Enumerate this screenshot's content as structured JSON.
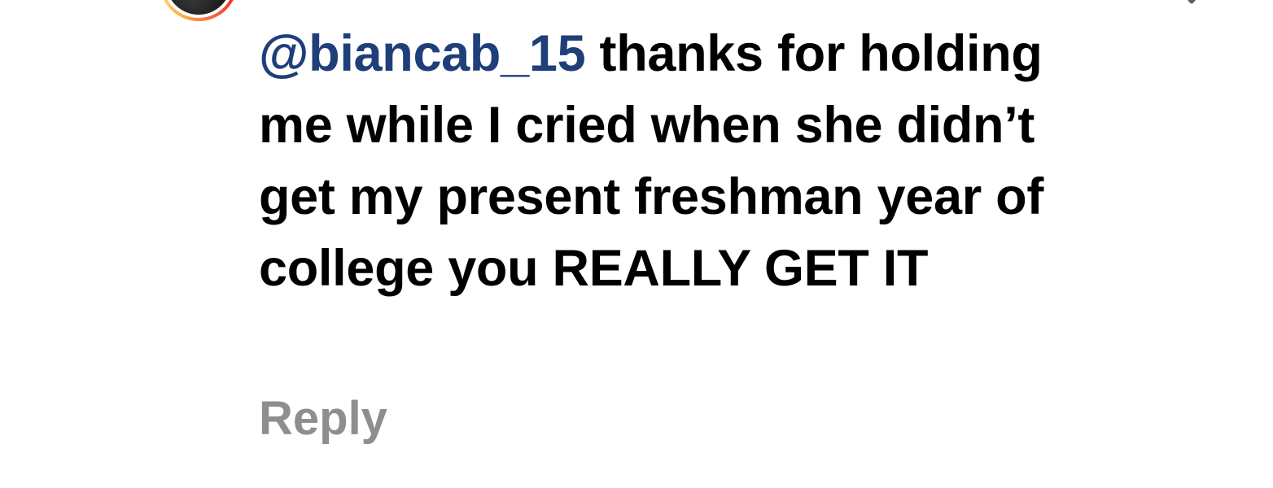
{
  "comment": {
    "mention": "@biancab_15",
    "body": " thanks for holding me while I cried when she didn’t get my present freshman year of college you REALLY GET IT",
    "reply_label": "Reply"
  },
  "icons": {
    "avatar": "user-avatar",
    "like": "heart-icon"
  },
  "colors": {
    "mention": "#1f3f7a",
    "text": "#000000",
    "reply": "#8e8e8e",
    "heart_outline": "#5f5f5f"
  }
}
